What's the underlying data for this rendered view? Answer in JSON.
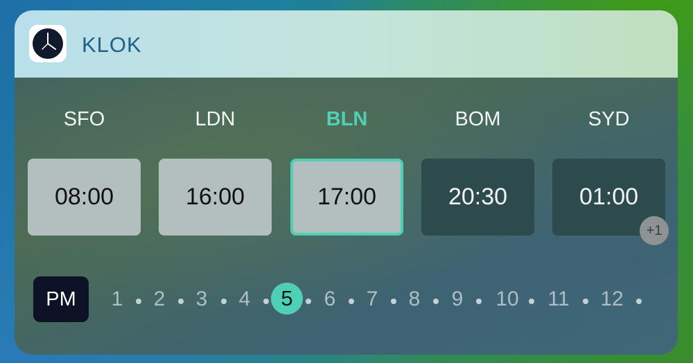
{
  "app": {
    "name": "KLOK",
    "icon": "clock-icon"
  },
  "cities": [
    {
      "code": "SFO",
      "time": "08:00",
      "style": "light"
    },
    {
      "code": "LDN",
      "time": "16:00",
      "style": "light"
    },
    {
      "code": "BLN",
      "time": "17:00",
      "style": "active"
    },
    {
      "code": "BOM",
      "time": "20:30",
      "style": "dark"
    },
    {
      "code": "SYD",
      "time": "01:00",
      "style": "dark"
    }
  ],
  "day_offset_badge": "+1",
  "period_button": "PM",
  "hours": [
    "1",
    "2",
    "3",
    "4",
    "5",
    "6",
    "7",
    "8",
    "9",
    "10",
    "11",
    "12"
  ],
  "selected_hour": "5",
  "colors": {
    "accent": "#4fd0b6",
    "pm_button": "#0d1226",
    "header_text": "#1d5f86"
  }
}
